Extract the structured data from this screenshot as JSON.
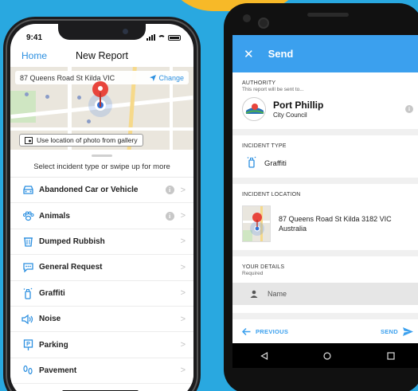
{
  "colors": {
    "background": "#29a8e0",
    "accent": "#2b8fe0",
    "android_appbar": "#3ba0ee",
    "accent_yellow": "#f7b928"
  },
  "iphone": {
    "status": {
      "time": "9:41"
    },
    "nav": {
      "back_label": "Home",
      "title": "New Report"
    },
    "map": {
      "address": "87 Queens Road St Kilda VIC",
      "change_label": "Change",
      "gallery_label": "Use location of photo from gallery"
    },
    "sheet": {
      "hint": "Select incident type or swipe up for more"
    },
    "categories": [
      {
        "label": "Abandoned Car or Vehicle",
        "icon": "car-icon",
        "info": true
      },
      {
        "label": "Animals",
        "icon": "paw-icon",
        "info": true
      },
      {
        "label": "Dumped Rubbish",
        "icon": "trash-icon",
        "info": false
      },
      {
        "label": "General Request",
        "icon": "chat-icon",
        "info": false
      },
      {
        "label": "Graffiti",
        "icon": "spray-can-icon",
        "info": false
      },
      {
        "label": "Noise",
        "icon": "speaker-icon",
        "info": false
      },
      {
        "label": "Parking",
        "icon": "parking-sign-icon",
        "info": false
      },
      {
        "label": "Pavement",
        "icon": "footprints-icon",
        "info": false
      }
    ]
  },
  "android": {
    "appbar": {
      "close": "✕",
      "title": "Send"
    },
    "authority": {
      "label": "AUTHORITY",
      "sub": "This report will be sent to...",
      "name1": "Port Phillip",
      "name2": "City Council",
      "logo_text": "PORT PHILLIP"
    },
    "incident_type": {
      "label": "INCIDENT TYPE",
      "value": "Graffiti"
    },
    "incident_location": {
      "label": "INCIDENT LOCATION",
      "line1": "87 Queens Road St Kilda 3182 VIC",
      "line2": "Australia"
    },
    "your_details": {
      "label": "YOUR DETAILS",
      "sub": "Required",
      "name_placeholder": "Name"
    },
    "footer": {
      "previous": "PREVIOUS",
      "send": "SEND"
    }
  }
}
